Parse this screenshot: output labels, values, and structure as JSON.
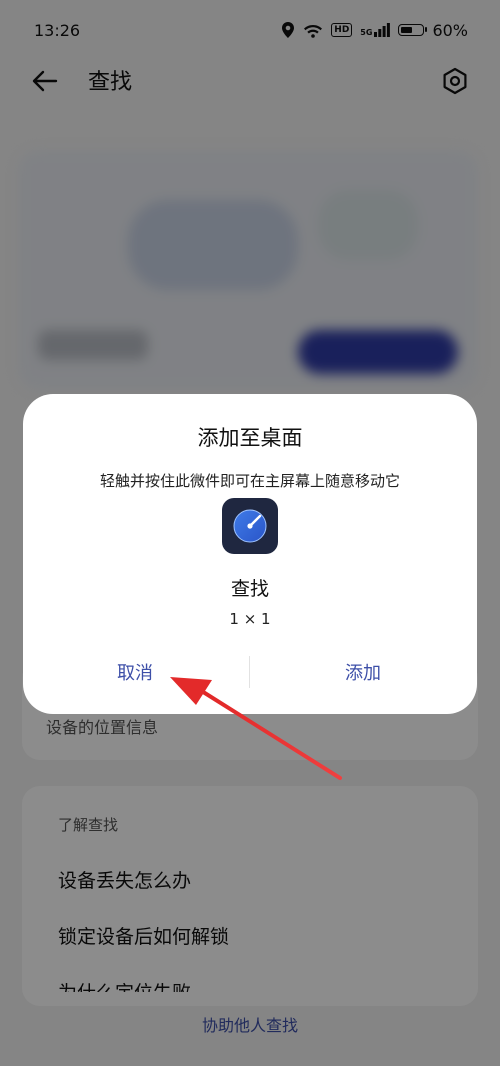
{
  "status_bar": {
    "time": "13:26",
    "hd_badge": "HD",
    "network": "5G",
    "battery_percent_text": "60%",
    "battery_level": 0.6
  },
  "app_bar": {
    "title": "查找"
  },
  "background": {
    "location_info": "设备的位置信息",
    "learn_section_title": "了解查找",
    "learn_items": [
      "设备丢失怎么办",
      "锁定设备后如何解锁",
      "为什么定位失败"
    ],
    "help_link": "协助他人查找"
  },
  "dialog": {
    "title": "添加至桌面",
    "description": "轻触并按住此微件即可在主屏幕上随意移动它",
    "widget_name": "查找",
    "widget_size": "1 × 1",
    "cancel_label": "取消",
    "add_label": "添加"
  },
  "colors": {
    "accent": "#3d4fa8",
    "annotation_arrow": "#e32a2a"
  }
}
